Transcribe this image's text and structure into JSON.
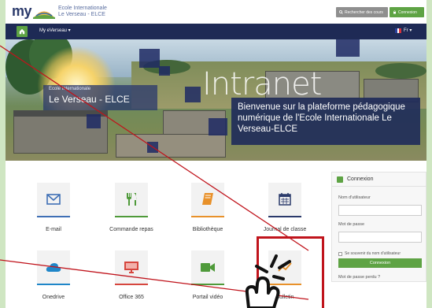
{
  "header": {
    "brand_my": "my",
    "brand_line1": "Ecole Internationale",
    "brand_line2": "Le Verseau - ELCE",
    "search_button": "Rechercher des cours",
    "login_button": "Connexion"
  },
  "nav": {
    "menu_label": "My eVerseau ▾",
    "lang_label": "Fr ▾"
  },
  "hero": {
    "logo_small": "Ecole Internationale",
    "logo_big": "Le Verseau - ELCE",
    "intranet": "Intranet",
    "welcome": "Bienvenue sur la plateforme pédagogique numérique de l'Ecole Internationale Le Verseau-ELCE"
  },
  "tiles": [
    {
      "label": "E-mail",
      "icon": "envelope-icon",
      "color": "#3f6fb5"
    },
    {
      "label": "Commande repas",
      "icon": "fork-knife-icon",
      "color": "#4f9a3a"
    },
    {
      "label": "Bibliothèque",
      "icon": "book-icon",
      "color": "#e8912a"
    },
    {
      "label": "Journal de classe",
      "icon": "calendar-icon",
      "color": "#2b3a6b"
    },
    {
      "label": "Onedrive",
      "icon": "cloud-icon",
      "color": "#1f86c8"
    },
    {
      "label": "Office 365",
      "icon": "monitor-icon",
      "color": "#d6463e"
    },
    {
      "label": "Portail vidéo",
      "icon": "video-camera-icon",
      "color": "#4f9a3a"
    },
    {
      "label": "Bulletin",
      "icon": "chart-icon",
      "color": "#e8912a"
    }
  ],
  "login": {
    "title": "Connexion",
    "username_label": "Nom d'utilisateur",
    "password_label": "Mot de passe",
    "remember_label": "Se souvenir du nom d'utilisateur",
    "submit_label": "Connexion",
    "forgot_label": "Mot de passe perdu ?"
  },
  "colors": {
    "navy": "#1e2a55",
    "green": "#5ea344",
    "annotation_red": "#c0141c"
  }
}
